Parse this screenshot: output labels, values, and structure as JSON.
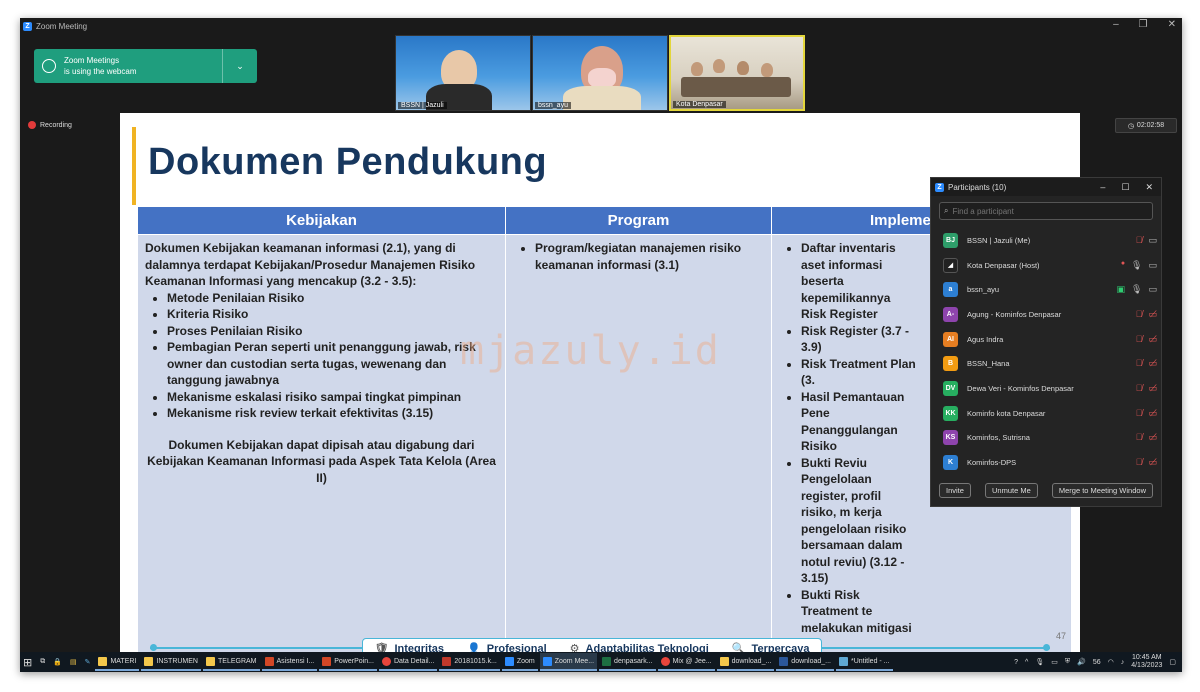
{
  "window": {
    "title": "Zoom Meeting",
    "controls": [
      "–",
      "❐",
      "✕"
    ]
  },
  "notice": {
    "line1": "Zoom Meetings",
    "line2": "is using the webcam",
    "chevron": "⌄"
  },
  "recording": {
    "label": "Recording"
  },
  "videos": [
    {
      "name": "BSSN | Jazuli"
    },
    {
      "name": "bssn_ayu"
    },
    {
      "name": "Kota Denpasar"
    }
  ],
  "timer": {
    "value": "02:02:58"
  },
  "slide": {
    "title": "Dokumen Pendukung",
    "columns": [
      "Kebijakan",
      "Program",
      "Implementasi"
    ],
    "col1": {
      "intro": "Dokumen Kebijakan keamanan informasi (2.1), yang di dalamnya terdapat Kebijakan/Prosedur Manajemen Risiko Keamanan Informasi yang mencakup (3.2 - 3.5):",
      "items": [
        "Metode Penilaian Risiko",
        "Kriteria Risiko",
        "Proses Penilaian Risiko",
        "Pembagian Peran seperti unit penanggung jawab, risk owner dan custodian serta tugas, wewenang dan tanggung jawabnya",
        "Mekanisme eskalasi risiko sampai tingkat pimpinan",
        "Mekanisme risk review terkait efektivitas (3.15)"
      ],
      "note": "Dokumen Kebijakan dapat dipisah atau digabung dari Kebijakan Keamanan Informasi pada Aspek Tata Kelola (Area II)"
    },
    "col2": {
      "items": [
        "Program/kegiatan manajemen risiko keamanan informasi (3.1)"
      ]
    },
    "col3": {
      "items": [
        "Daftar inventaris aset informasi beserta kepemilikannya Risk Register",
        "Risk Register (3.7 - 3.9)",
        "Risk Treatment Plan (3.",
        "Hasil Pemantauan Pene Penanggulangan Risiko",
        "Bukti Reviu Pengelolaan register, profil risiko, m kerja pengelolaan risiko bersamaan dalam notul reviu) (3.12 - 3.15)",
        "Bukti Risk Treatment te melakukan mitigasi risi"
      ]
    },
    "watermark": "mjazuly.id",
    "footer": [
      {
        "icon": "🛡",
        "label": "Integritas"
      },
      {
        "icon": "👤",
        "label": "Profesional"
      },
      {
        "icon": "⚙",
        "label": "Adaptabilitas Teknologi"
      },
      {
        "icon": "🔍",
        "label": "Terpercaya"
      }
    ],
    "page": "47"
  },
  "participants": {
    "title": "Participants (10)",
    "search_placeholder": "Find a participant",
    "list": [
      {
        "initials": "BJ",
        "name": "BSSN | Jazuli (Me)",
        "color": "#2e9e6a"
      },
      {
        "initials": "",
        "name": "Kota Denpasar (Host)",
        "color": "#222222"
      },
      {
        "initials": "a",
        "name": "bssn_ayu",
        "color": "#2d7fd3"
      },
      {
        "initials": "A-",
        "name": "Agung - Kominfos Denpasar",
        "color": "#8e44ad"
      },
      {
        "initials": "AI",
        "name": "Agus Indra",
        "color": "#e67e22"
      },
      {
        "initials": "B",
        "name": "BSSN_Hana",
        "color": "#f39c12"
      },
      {
        "initials": "DV",
        "name": "Dewa Veri - Kominfos Denpasar",
        "color": "#27ae60"
      },
      {
        "initials": "KK",
        "name": "Kominfo kota Denpasar",
        "color": "#27ae60"
      },
      {
        "initials": "KS",
        "name": "Kominfos, Sutrisna",
        "color": "#8e44ad"
      },
      {
        "initials": "K",
        "name": "Kominfos-DPS",
        "color": "#2d7fd3"
      }
    ],
    "buttons": [
      "Invite",
      "Unmute Me",
      "Merge to Meeting Window"
    ]
  },
  "taskbar": {
    "items": [
      {
        "label": "MATERI",
        "color": "#f3c74b"
      },
      {
        "label": "INSTRUMEN",
        "color": "#f3c74b"
      },
      {
        "label": "TELEGRAM",
        "color": "#f3c74b"
      },
      {
        "label": "Asistensi I...",
        "color": "#d24726"
      },
      {
        "label": "PowerPoin...",
        "color": "#d24726"
      },
      {
        "label": "Data Detail...",
        "color": "#e8453c"
      },
      {
        "label": "20181015.k...",
        "color": "#c0392b"
      },
      {
        "label": "Zoom",
        "color": "#2d8cff"
      },
      {
        "label": "Zoom Mee...",
        "color": "#2d8cff"
      },
      {
        "label": "denpasark...",
        "color": "#1d6f42"
      },
      {
        "label": "Mix @ Jee...",
        "color": "#e8453c"
      },
      {
        "label": "download_...",
        "color": "#f3c74b"
      },
      {
        "label": "download_...",
        "color": "#2b579a"
      },
      {
        "label": "*Untitled - ...",
        "color": "#5fa8d3"
      }
    ],
    "volume": "56",
    "time": "10:45 AM",
    "date": "4/13/2023"
  }
}
